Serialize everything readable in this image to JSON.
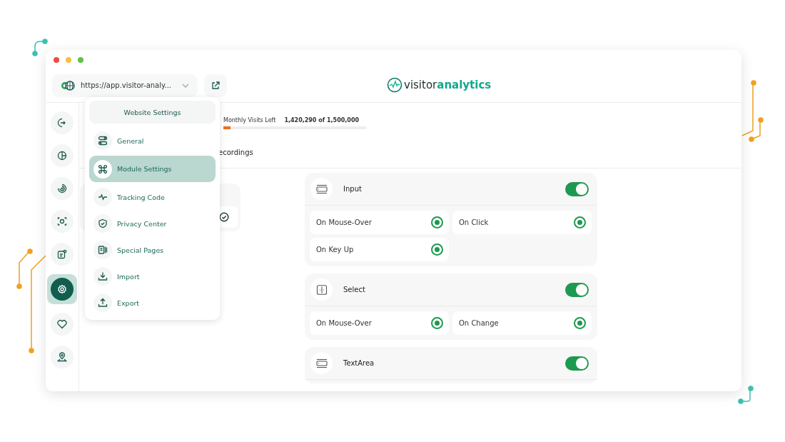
{
  "window": {
    "controls": [
      {
        "color": "#ee4c45"
      },
      {
        "color": "#f4c23a"
      },
      {
        "color": "#5fc248"
      }
    ]
  },
  "address_bar": {
    "url": "https://app.visitor-analy..."
  },
  "logo": {
    "light": "visitor",
    "bold": "analytics"
  },
  "sidebar": {
    "items": [
      {
        "selected": false
      },
      {
        "selected": false
      },
      {
        "selected": false
      },
      {
        "selected": false
      },
      {
        "selected": false
      },
      {
        "selected": true
      },
      {
        "selected": false
      },
      {
        "selected": false
      }
    ]
  },
  "usage": {
    "label": "Monthly Visits Left",
    "value": "1,420,290 of 1,500,000",
    "level": 0.05
  },
  "tabs": [
    {
      "label": "ecordings",
      "selected": false
    }
  ],
  "menu": {
    "title": "Website Settings",
    "items": [
      {
        "label": "General",
        "selected": false
      },
      {
        "label": "Module Settings",
        "selected": true
      },
      {
        "label": "Tracking Code",
        "selected": false
      },
      {
        "label": "Privacy Center",
        "selected": false
      },
      {
        "label": "Special Pages",
        "selected": false
      },
      {
        "label": "Import",
        "selected": false
      },
      {
        "label": "Export",
        "selected": false
      }
    ]
  },
  "left_card": {
    "checked": true
  },
  "modules": [
    {
      "name": "Input",
      "on": true,
      "events": [
        {
          "label": "On Mouse-Over",
          "checked": true
        },
        {
          "label": "On Click",
          "checked": true
        },
        {
          "label": "On Key Up",
          "checked": true
        }
      ]
    },
    {
      "name": "Select",
      "on": true,
      "events": [
        {
          "label": "On Mouse-Over",
          "checked": true
        },
        {
          "label": "On Change",
          "checked": true
        }
      ]
    },
    {
      "name": "TextArea",
      "on": true
    }
  ]
}
